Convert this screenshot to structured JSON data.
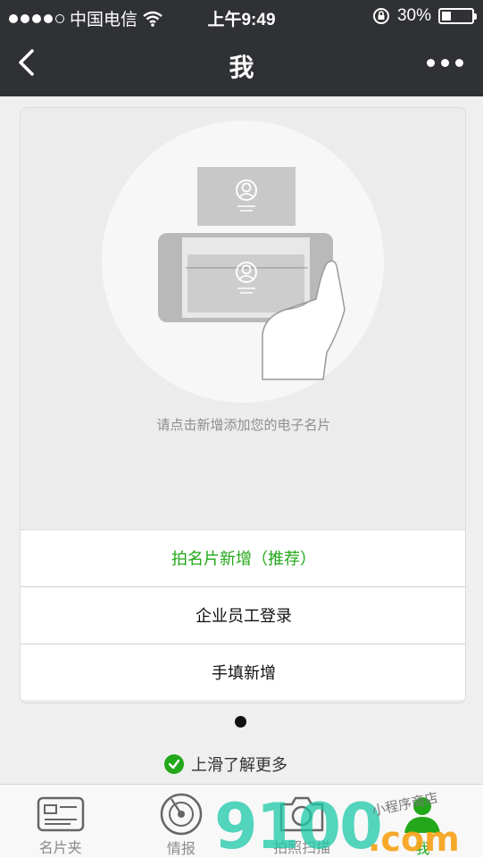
{
  "status_bar": {
    "carrier": "中国电信",
    "time": "上午9:49",
    "battery_percent": "30%",
    "battery_level": 0.3
  },
  "nav": {
    "title": "我",
    "back_icon": "back-chevron-icon",
    "more_icon": "more-dots-icon"
  },
  "card": {
    "hint": "请点击新增添加您的电子名片",
    "buttons": [
      {
        "label": "拍名片新增（推荐）",
        "color": "#22a81a"
      },
      {
        "label": "企业员工登录"
      },
      {
        "label": "手填新增"
      }
    ]
  },
  "more": {
    "label": "上滑了解更多"
  },
  "tabs": [
    {
      "label": "名片夹",
      "icon": "card-holder-icon"
    },
    {
      "label": "情报",
      "icon": "radar-icon"
    },
    {
      "label": "拍照扫描",
      "icon": "camera-icon"
    },
    {
      "label": "我",
      "icon": "person-icon",
      "active": true
    }
  ],
  "watermark": {
    "text": "9100",
    "domain": ".com",
    "caption": "小程序商店"
  },
  "colors": {
    "accent": "#22a81a",
    "bar": "#2f3134"
  }
}
